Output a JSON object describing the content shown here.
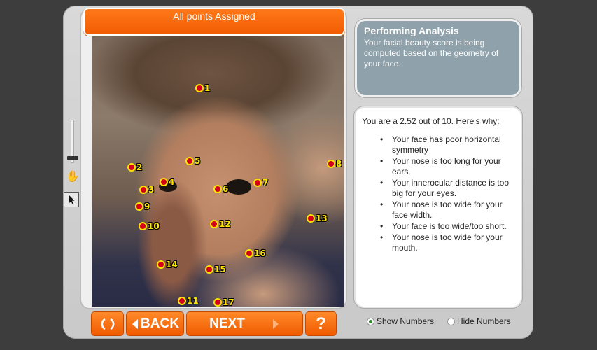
{
  "header": {
    "title": "All points Assigned"
  },
  "analysis": {
    "title": "Performing Analysis",
    "text": "Your facial beauty score is being computed based on the geometry of your face."
  },
  "result": {
    "summary": "You are a 2.52 out of 10.  Here's why:",
    "reasons": [
      "Your face has poor horizontal symmetry",
      "Your nose is too long for your ears.",
      "Your innerocular distance is too big for your eyes.",
      "Your nose is too wide for your face width.",
      "Your face is too wide/too short.",
      "Your nose is too wide for your mouth."
    ]
  },
  "points": [
    "1",
    "2",
    "3",
    "4",
    "5",
    "6",
    "7",
    "8",
    "9",
    "10",
    "11",
    "12",
    "13",
    "14",
    "15",
    "16",
    "17"
  ],
  "buttons": {
    "reset_icon": "reset-icon",
    "back_label": "BACK",
    "next_label": "NEXT",
    "help_label": "?"
  },
  "options": {
    "show_numbers": "Show Numbers",
    "hide_numbers": "Hide Numbers",
    "selected": "show_numbers"
  },
  "colors": {
    "accent": "#f26a0a",
    "analysis_bg": "#8fa2ab",
    "point_fill": "#d4001a",
    "point_ring": "#ffe400"
  }
}
